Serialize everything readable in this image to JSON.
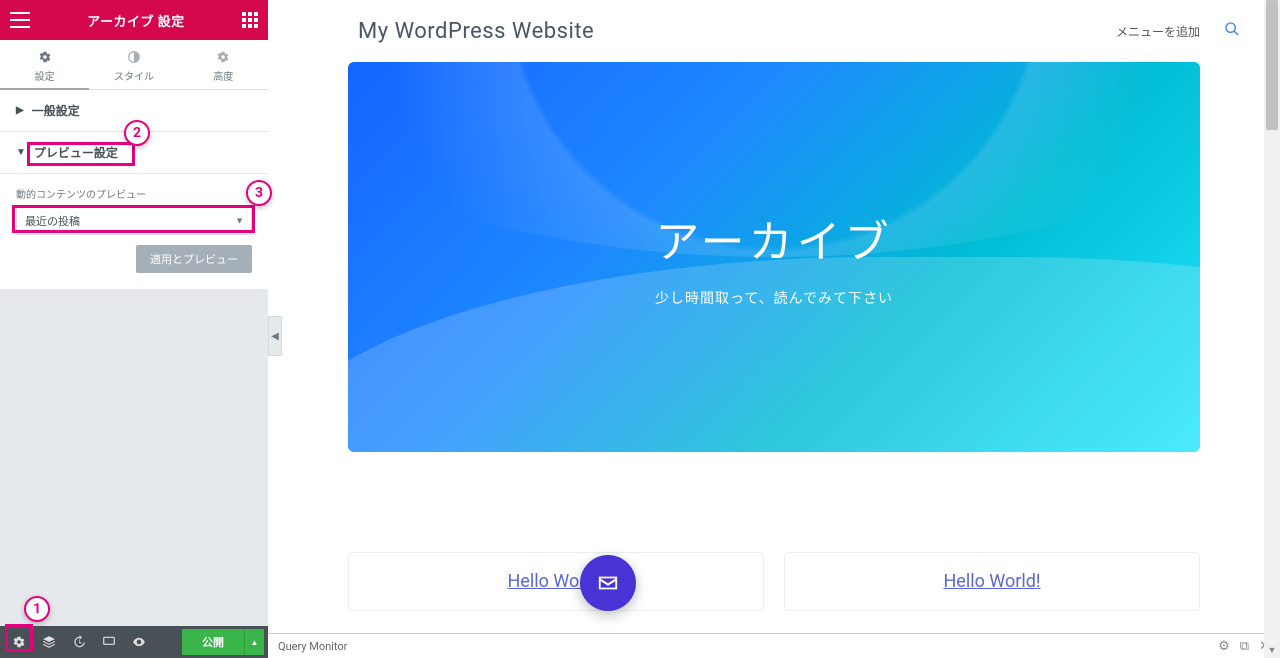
{
  "header": {
    "title": "アーカイブ 設定"
  },
  "tabs": {
    "settings": "設定",
    "style": "スタイル",
    "advanced": "高度"
  },
  "sections": {
    "general": {
      "label": "一般設定"
    },
    "preview": {
      "label": "プレビュー設定",
      "field_label": "動的コンテンツのプレビュー",
      "selected": "最近の投稿",
      "apply": "適用とプレビュー"
    }
  },
  "footer": {
    "publish": "公開"
  },
  "site": {
    "title": "My WordPress Website",
    "add_menu": "メニューを追加",
    "hero_title": "アーカイブ",
    "hero_sub": "少し時間取って、読んでみて下さい",
    "card1": "Hello World!",
    "card2": "Hello World!"
  },
  "qm": {
    "label": "Query Monitor"
  },
  "annotations": {
    "n1": "1",
    "n2": "2",
    "n3": "3"
  }
}
